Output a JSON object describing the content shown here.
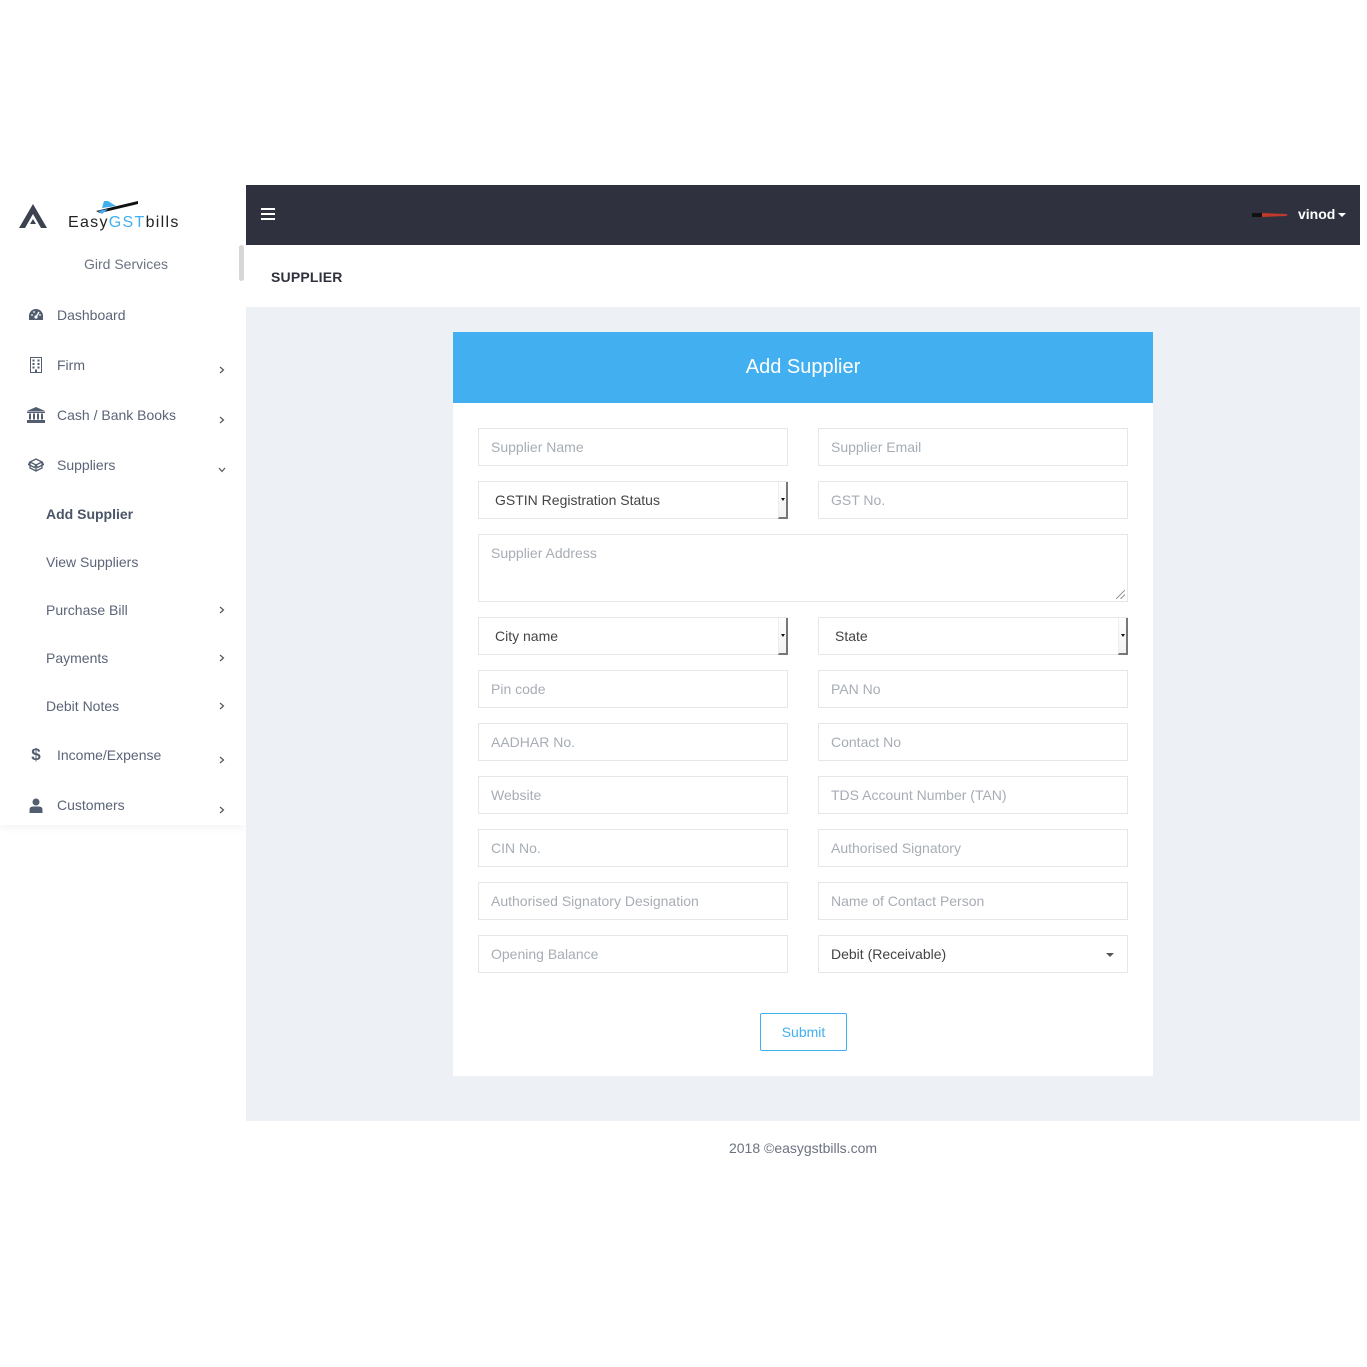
{
  "brand": {
    "name_prefix": "Easy",
    "name_accent": "GST",
    "name_suffix": "bills",
    "sub_brand": "Gird Services",
    "accent_color": "#42b0f0"
  },
  "sidebar": {
    "items": [
      {
        "label": "Dashboard",
        "icon": "dashboard-gauge-icon",
        "has_chevron": false
      },
      {
        "label": "Firm",
        "icon": "building-icon",
        "has_chevron": true
      },
      {
        "label": "Cash / Bank Books",
        "icon": "bank-icon",
        "has_chevron": true
      },
      {
        "label": "Suppliers",
        "icon": "box-icon",
        "has_chevron": true,
        "expanded": true
      },
      {
        "label": "Income/Expense",
        "icon": "dollar-icon",
        "has_chevron": true
      },
      {
        "label": "Customers",
        "icon": "user-icon",
        "has_chevron": true
      }
    ],
    "sub_items": [
      {
        "label": "Add Supplier",
        "active": true,
        "has_chevron": false
      },
      {
        "label": "View Suppliers",
        "active": false,
        "has_chevron": false
      },
      {
        "label": "Purchase Bill",
        "active": false,
        "has_chevron": true
      },
      {
        "label": "Payments",
        "active": false,
        "has_chevron": true
      },
      {
        "label": "Debit Notes",
        "active": false,
        "has_chevron": true
      }
    ]
  },
  "topbar": {
    "menu_icon": "hamburger-icon",
    "user_name": "vinod"
  },
  "page": {
    "title": "SUPPLIER"
  },
  "form": {
    "title": "Add Supplier",
    "fields": {
      "supplier_name": {
        "placeholder": "Supplier Name",
        "value": ""
      },
      "supplier_email": {
        "placeholder": "Supplier Email",
        "value": ""
      },
      "gstin_status": {
        "selected": "GSTIN Registration Status"
      },
      "gst_no": {
        "placeholder": "GST No.",
        "value": ""
      },
      "supplier_address": {
        "placeholder": "Supplier Address",
        "value": ""
      },
      "city": {
        "selected": "City name"
      },
      "state": {
        "selected": "State"
      },
      "pin_code": {
        "placeholder": "Pin code",
        "value": ""
      },
      "pan_no": {
        "placeholder": "PAN No",
        "value": ""
      },
      "aadhar_no": {
        "placeholder": "AADHAR No.",
        "value": ""
      },
      "contact_no": {
        "placeholder": "Contact No",
        "value": ""
      },
      "website": {
        "placeholder": "Website",
        "value": ""
      },
      "tan": {
        "placeholder": "TDS Account Number (TAN)",
        "value": ""
      },
      "cin_no": {
        "placeholder": "CIN No.",
        "value": ""
      },
      "authorised_signatory": {
        "placeholder": "Authorised Signatory",
        "value": ""
      },
      "signatory_designation": {
        "placeholder": "Authorised Signatory Designation",
        "value": ""
      },
      "contact_person": {
        "placeholder": "Name of Contact Person",
        "value": ""
      },
      "opening_balance": {
        "placeholder": "Opening Balance",
        "value": ""
      },
      "balance_type": {
        "selected": "Debit (Receivable)"
      }
    },
    "submit_label": "Submit"
  },
  "footer": {
    "text": "2018 ©easygstbills.com"
  }
}
